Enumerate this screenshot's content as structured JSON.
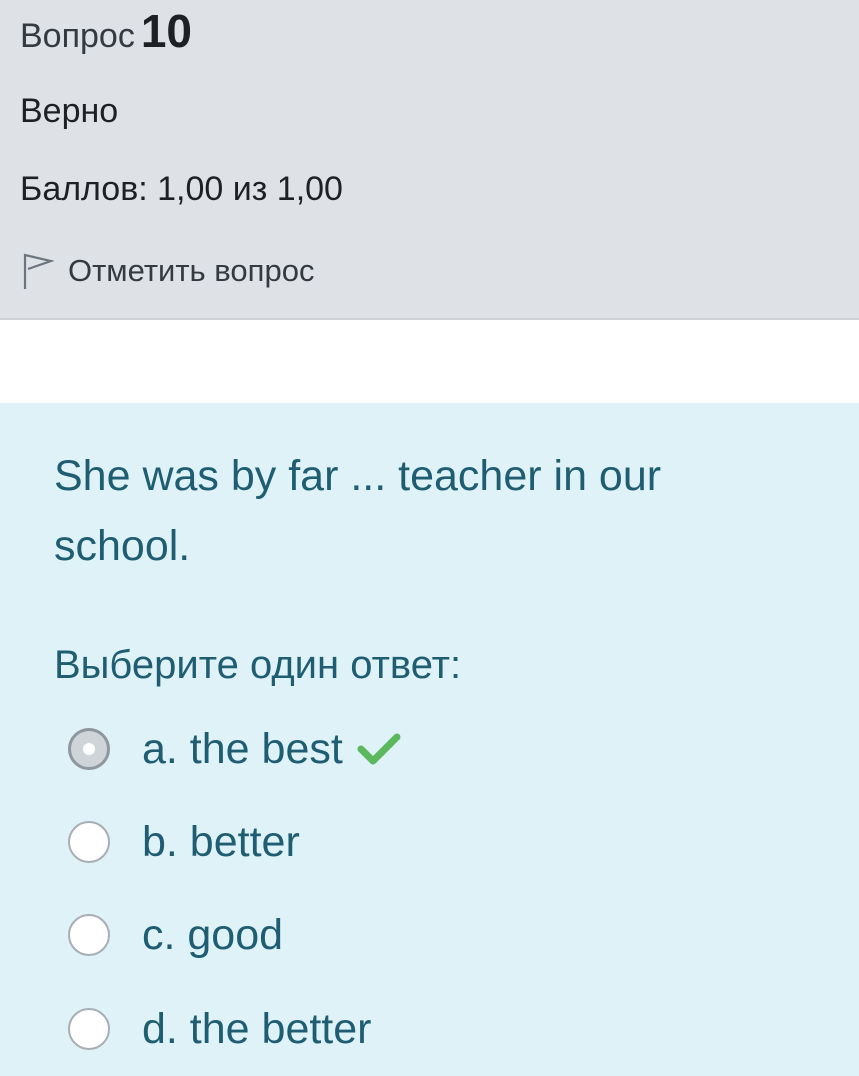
{
  "info": {
    "question_label": "Вопрос",
    "question_number": "10",
    "state": "Верно",
    "grade": "Баллов: 1,00 из 1,00",
    "flag_label": "Отметить вопрос"
  },
  "question": {
    "text": "She was by far ... teacher in our school.",
    "prompt": "Выберите один ответ:",
    "answers": [
      {
        "label": "a. the best",
        "selected": true,
        "correct": true
      },
      {
        "label": "b. better",
        "selected": false
      },
      {
        "label": "c. good",
        "selected": false
      },
      {
        "label": "d. the better",
        "selected": false
      }
    ]
  },
  "icons": {
    "flag": "flag-icon",
    "correct": "check-icon",
    "correct_color": "#5cb85c"
  },
  "colors": {
    "info_bg": "#dee2e6",
    "content_bg": "#def2f8",
    "content_text": "#1f5e72"
  }
}
